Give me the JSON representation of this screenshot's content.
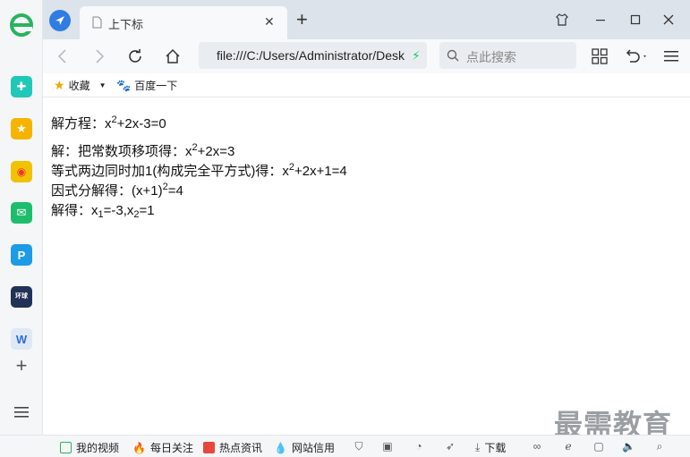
{
  "tab": {
    "title": "上下标"
  },
  "address": {
    "url": "file:///C:/Users/Administrator/Desktop/"
  },
  "search": {
    "placeholder": "点此搜索"
  },
  "bookmarks": {
    "favorites": "收藏",
    "baidu": "百度一下"
  },
  "content": {
    "l1": {
      "a": "解方程：x",
      "b": "2",
      "c": "+2x-3=0"
    },
    "l2": {
      "a": "解：把常数项移项得：x",
      "b": "2",
      "c": "+2x=3"
    },
    "l3": {
      "a": "等式两边同时加1(构成完全平方式)得：x",
      "b": "2",
      "c": "+2x+1=4"
    },
    "l4": {
      "a": "因式分解得：(x+1)",
      "b": "2",
      "c": "=4"
    },
    "l5": {
      "a": "解得：x",
      "b": "1",
      "c": "=-3,x",
      "d": "2",
      "e": "=1"
    }
  },
  "statusbar": {
    "my_video": "我的视频",
    "daily_follow": "每日关注",
    "hot_news": "热点资讯",
    "site_trust": "网站信用",
    "download": "下载"
  },
  "watermark": "最需教育",
  "colors": {
    "accent": "#2f7de1",
    "tabbar": "#dde3ea",
    "toolbar": "#f7f9fb"
  }
}
